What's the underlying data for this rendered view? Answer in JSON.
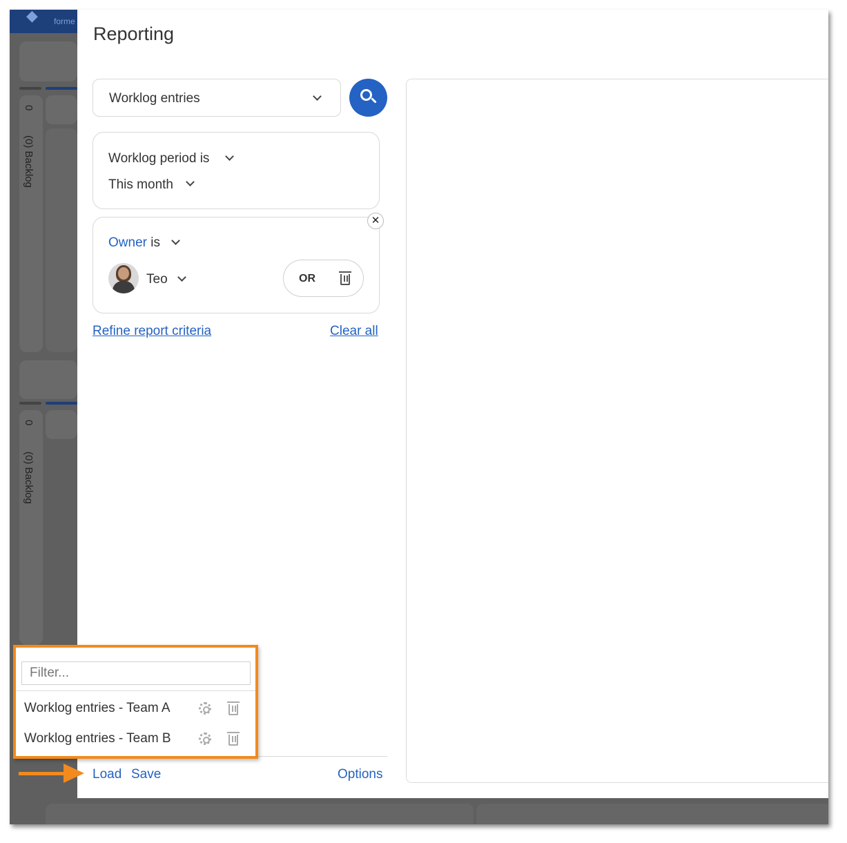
{
  "background": {
    "logo_text": "forme",
    "columns": [
      {
        "count": "0",
        "label": "(0) Backlog"
      },
      {
        "count": "0",
        "label": "(0) Backlog"
      }
    ]
  },
  "panel": {
    "title": "Reporting",
    "report_type": "Worklog entries",
    "criteria": [
      {
        "field": "Worklog period is",
        "value": "This month"
      },
      {
        "field_link": "Owner",
        "field_op": "is",
        "value": "Teo",
        "or_label": "OR"
      }
    ],
    "refine_link": "Refine report criteria",
    "clear_link": "Clear all"
  },
  "load_popup": {
    "filter_placeholder": "Filter...",
    "saved_reports": [
      {
        "name": "Worklog entries - Team A"
      },
      {
        "name": "Worklog entries - Team B"
      }
    ]
  },
  "footer": {
    "load": "Load",
    "save": "Save",
    "options": "Options"
  },
  "colors": {
    "accent": "#2462c3",
    "highlight": "#f28a1d",
    "overlay": "#5f5f5f"
  }
}
